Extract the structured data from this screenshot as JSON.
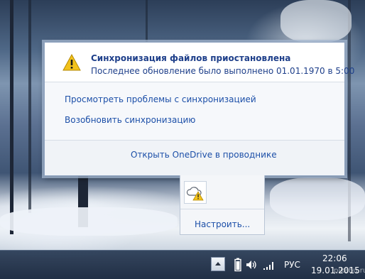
{
  "popup": {
    "status_title": "Синхронизация файлов приостановлена",
    "status_subtitle": "Последнее обновление было выполнено 01.01.1970 в 5:00",
    "actions": [
      {
        "label": "Просмотреть проблемы с синхронизацией"
      },
      {
        "label": "Возобновить синхронизацию"
      }
    ],
    "footer_link": "Открыть OneDrive в проводнике",
    "icon": "warning-triangle-icon"
  },
  "tray_overflow": {
    "app_icon": "onedrive-warning-icon",
    "customize_label": "Настроить..."
  },
  "taskbar": {
    "language": "РУС",
    "time": "22:06",
    "date": "19.01.2015",
    "watermark": "pikabu.ru",
    "icons": [
      "show-hidden-icons-icon",
      "battery-icon",
      "volume-icon",
      "network-signal-icon"
    ]
  },
  "colors": {
    "link": "#1c4fa8",
    "title": "#1e3f8a",
    "warning": "#f2c21b"
  }
}
